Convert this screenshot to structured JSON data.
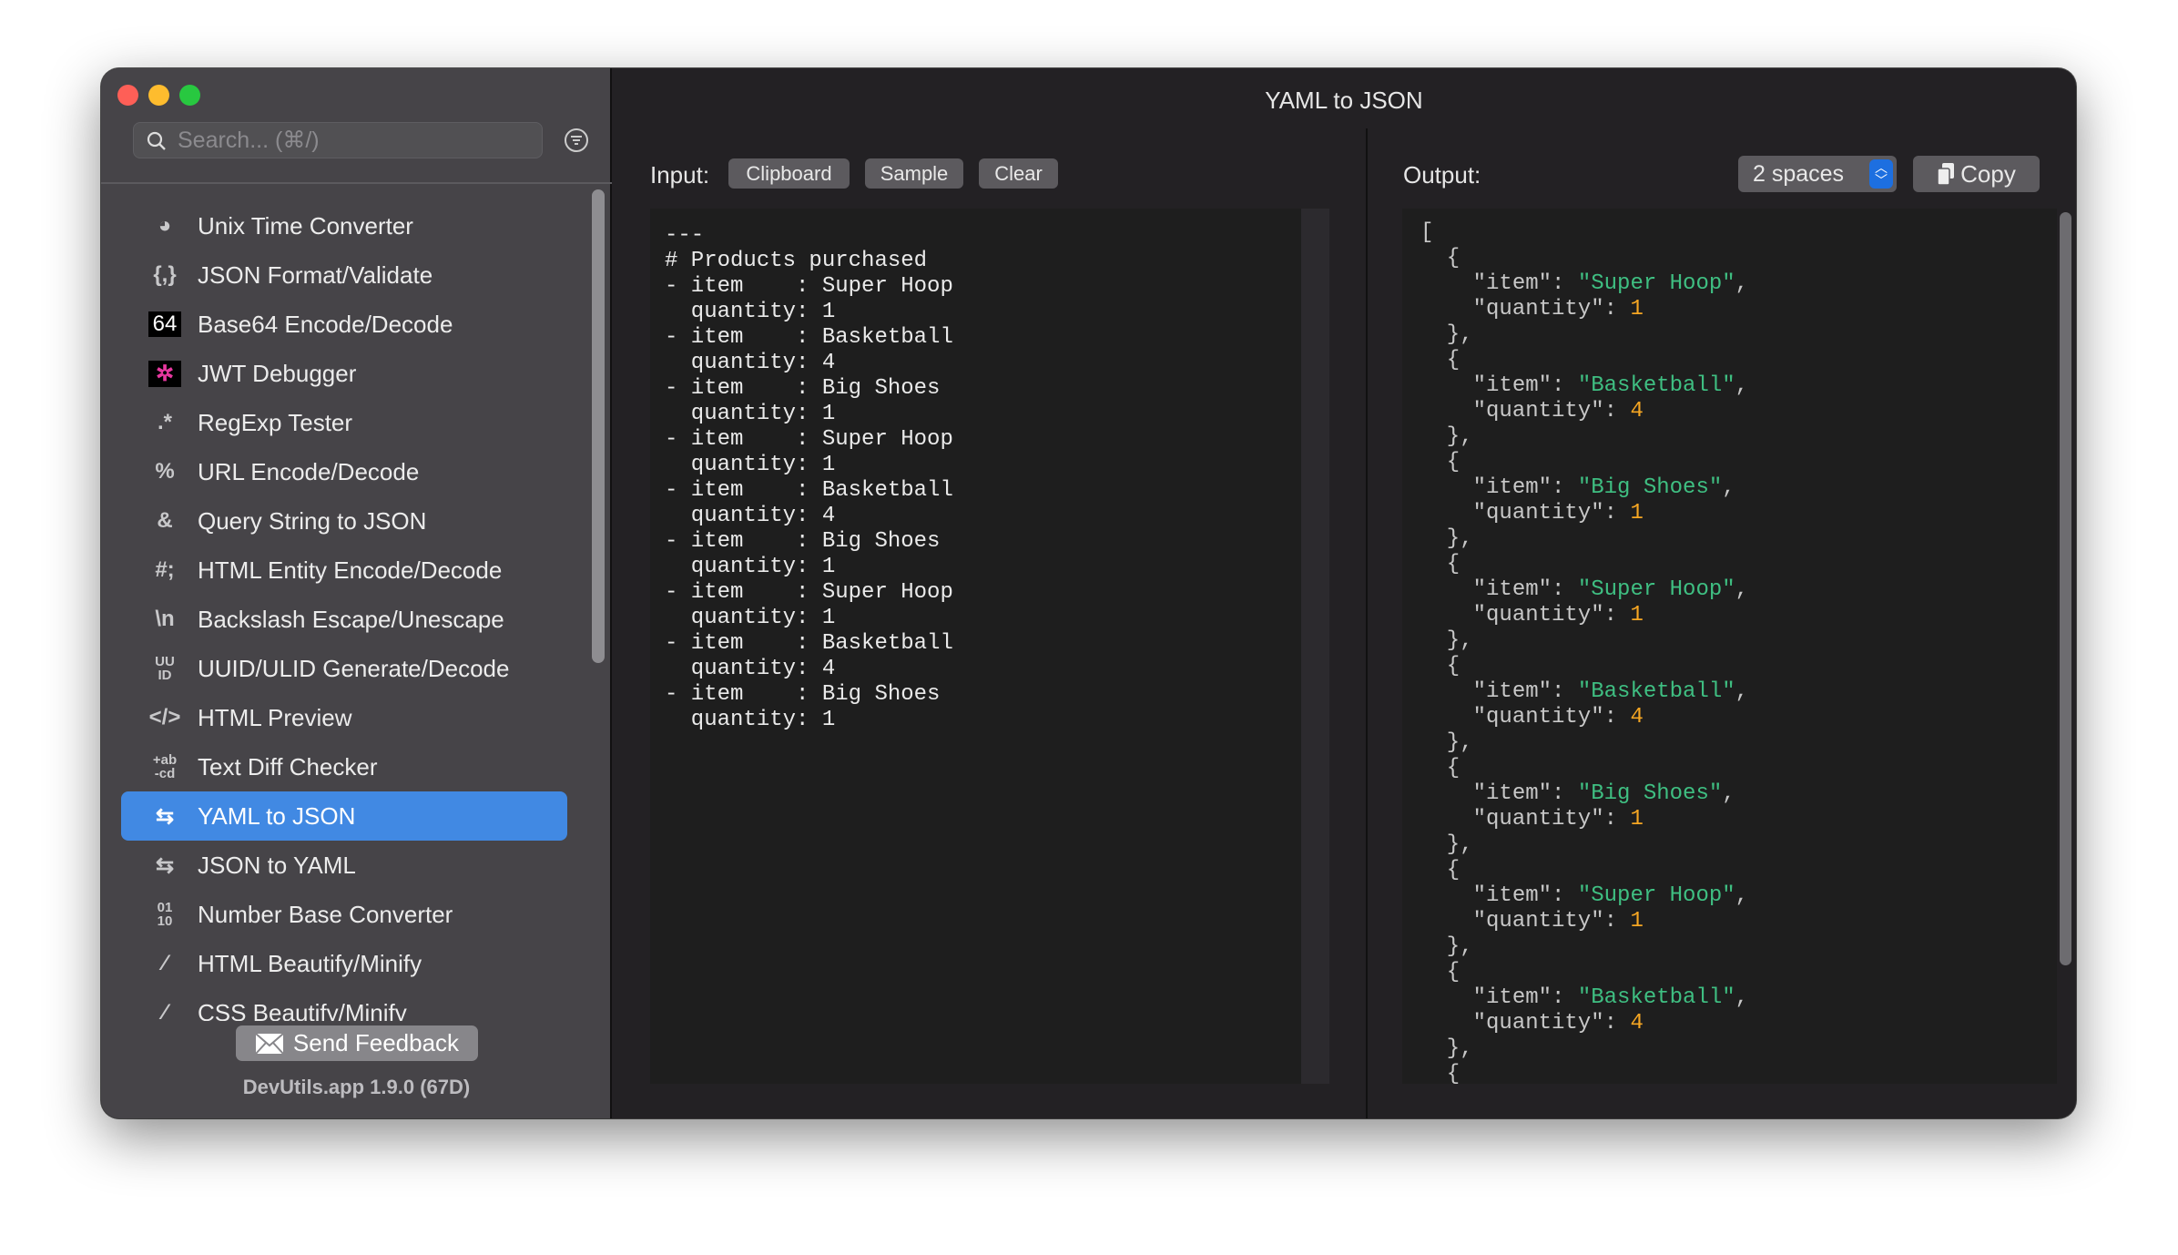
{
  "window": {
    "title": "YAML to JSON",
    "traffic_colors": [
      "#fe5f57",
      "#febc2e",
      "#28c840"
    ]
  },
  "sidebar": {
    "search_placeholder": "Search... (⌘/)",
    "items": [
      {
        "label": "Unix Time Converter",
        "icon": "clock-icon"
      },
      {
        "label": "JSON Format/Validate",
        "icon": "braces-icon"
      },
      {
        "label": "Base64 Encode/Decode",
        "icon": "base64-icon"
      },
      {
        "label": "JWT Debugger",
        "icon": "jwt-icon"
      },
      {
        "label": "RegExp Tester",
        "icon": "regexp-icon"
      },
      {
        "label": "URL Encode/Decode",
        "icon": "percent-icon"
      },
      {
        "label": "Query String to JSON",
        "icon": "ampersand-icon"
      },
      {
        "label": "HTML Entity Encode/Decode",
        "icon": "hash-icon"
      },
      {
        "label": "Backslash Escape/Unescape",
        "icon": "backslash-icon"
      },
      {
        "label": "UUID/ULID Generate/Decode",
        "icon": "uuid-icon"
      },
      {
        "label": "HTML Preview",
        "icon": "code-icon"
      },
      {
        "label": "Text Diff Checker",
        "icon": "diff-icon"
      },
      {
        "label": "YAML to JSON",
        "icon": "swap-icon",
        "selected": true
      },
      {
        "label": "JSON to YAML",
        "icon": "swap-icon"
      },
      {
        "label": "Number Base Converter",
        "icon": "binary-icon"
      },
      {
        "label": "HTML Beautify/Minify",
        "icon": "magic-wand-icon"
      },
      {
        "label": "CSS Beautify/Minify",
        "icon": "magic-wand-icon"
      }
    ],
    "icon_glyphs": [
      "◕",
      "{,}",
      "64",
      "✲",
      ".*",
      "%",
      "&",
      "#;",
      "\\n",
      "UU\nID",
      "</>",
      "+ab\n-cd",
      "⇆",
      "⇆",
      "01\n10",
      "⁄",
      "⁄"
    ],
    "feedback_label": "Send Feedback",
    "version": "DevUtils.app 1.9.0 (67D)",
    "accent": "#4189e3"
  },
  "input": {
    "label": "Input:",
    "buttons": [
      "Clipboard",
      "Sample",
      "Clear"
    ],
    "lines": [
      "---",
      "# Products purchased",
      "- item    : Super Hoop",
      "  quantity: 1",
      "- item    : Basketball",
      "  quantity: 4",
      "- item    : Big Shoes",
      "  quantity: 1",
      "- item    : Super Hoop",
      "  quantity: 1",
      "- item    : Basketball",
      "  quantity: 4",
      "- item    : Big Shoes",
      "  quantity: 1",
      "- item    : Super Hoop",
      "  quantity: 1",
      "- item    : Basketball",
      "  quantity: 4",
      "- item    : Big Shoes",
      "  quantity: 1"
    ]
  },
  "output": {
    "label": "Output:",
    "indent_select": "2 spaces",
    "copy_label": "Copy",
    "items": [
      {
        "item": "Super Hoop",
        "quantity": 1
      },
      {
        "item": "Basketball",
        "quantity": 4
      },
      {
        "item": "Big Shoes",
        "quantity": 1
      },
      {
        "item": "Super Hoop",
        "quantity": 1
      },
      {
        "item": "Basketball",
        "quantity": 4
      },
      {
        "item": "Big Shoes",
        "quantity": 1
      },
      {
        "item": "Super Hoop",
        "quantity": 1
      },
      {
        "item": "Basketball",
        "quantity": 4
      }
    ],
    "string_color": "#3fbf82",
    "number_color": "#f5a623"
  }
}
